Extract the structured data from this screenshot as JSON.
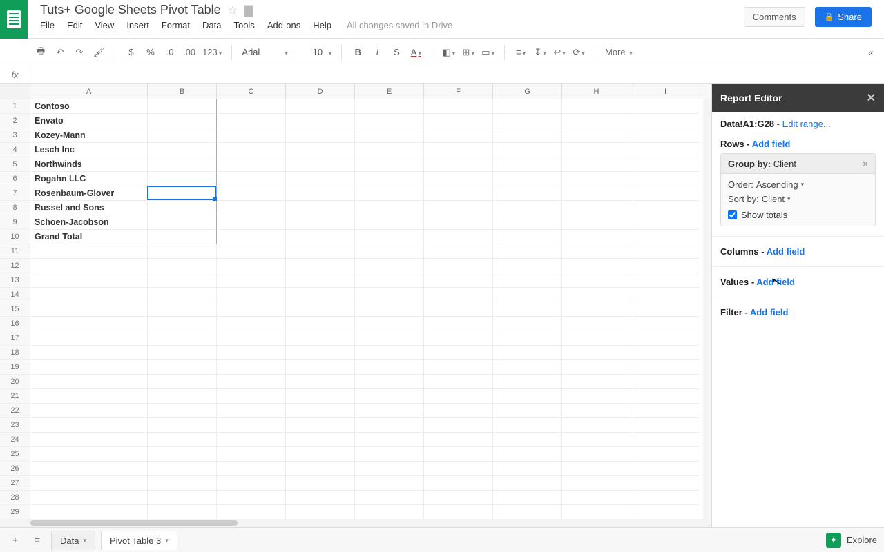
{
  "doc": {
    "title": "Tuts+ Google Sheets Pivot Table"
  },
  "menu": {
    "file": "File",
    "edit": "Edit",
    "view": "View",
    "insert": "Insert",
    "format": "Format",
    "data": "Data",
    "tools": "Tools",
    "addons": "Add-ons",
    "help": "Help",
    "status": "All changes saved in Drive"
  },
  "topbar": {
    "comments": "Comments",
    "share": "Share"
  },
  "toolbar": {
    "currency": "$",
    "percent": "%",
    "dec_dec": ".0",
    "dec_inc": ".00",
    "numfmt": "123",
    "font": "Arial",
    "size": "10",
    "bold": "B",
    "italic": "I",
    "strike": "S",
    "textcolor": "A",
    "more": "More"
  },
  "formula": {
    "fx": "fx",
    "value": ""
  },
  "columns": [
    "A",
    "B",
    "C",
    "D",
    "E",
    "F",
    "G",
    "H",
    "I"
  ],
  "pivot_rows": [
    "Contoso",
    "Envato",
    "Kozey-Mann",
    "Lesch Inc",
    "Northwinds",
    "Rogahn LLC",
    "Rosenbaum-Glover",
    "Russel and Sons",
    "Schoen-Jacobson",
    "Grand Total"
  ],
  "row_count": 29,
  "selected": {
    "row": 7,
    "col": "B"
  },
  "report": {
    "title": "Report Editor",
    "range": "Data!A1:G28",
    "edit_range": "Edit range...",
    "rows_label": "Rows",
    "columns_label": "Columns",
    "values_label": "Values",
    "filter_label": "Filter",
    "add_field": "Add field",
    "group": {
      "label": "Group by:",
      "field": "Client",
      "order_label": "Order:",
      "order": "Ascending",
      "sort_label": "Sort by:",
      "sort": "Client",
      "show_totals": "Show totals",
      "show_totals_checked": true
    }
  },
  "sheets": {
    "add": "+",
    "all": "≡",
    "tab1": "Data",
    "tab2": "Pivot Table 3",
    "explore": "Explore"
  }
}
